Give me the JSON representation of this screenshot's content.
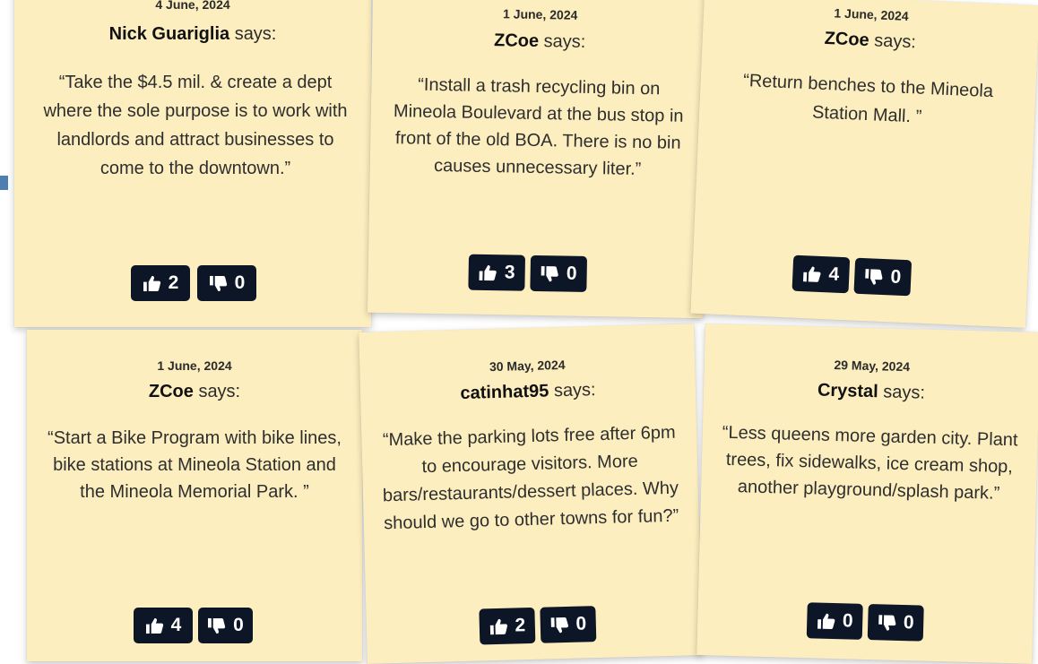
{
  "suggestions": [
    {
      "date": "4 June, 2024",
      "author": "Nick Guariglia",
      "says": "says:",
      "quote": "“Take the $4.5 mil. & create a dept where the sole purpose is to work with landlords and attract businesses to come to the downtown.”",
      "up": "2",
      "down": "0"
    },
    {
      "date": "1 June, 2024",
      "author": "ZCoe",
      "says": "says:",
      "quote": "“Install a trash recycling bin on Mineola Boulevard at the bus stop in front of the old BOA. There is no bin causes unnecessary liter.”",
      "up": "3",
      "down": "0"
    },
    {
      "date": "1 June, 2024",
      "author": "ZCoe",
      "says": "says:",
      "quote": "“Return benches to the Mineola Station Mall. ”",
      "up": "4",
      "down": "0"
    },
    {
      "date": "1 June, 2024",
      "author": "ZCoe",
      "says": "says:",
      "quote": "“Start a Bike Program with bike lines, bike stations at Mineola Station and the Mineola Memorial Park. ”",
      "up": "4",
      "down": "0"
    },
    {
      "date": "30 May, 2024",
      "author": "catinhat95",
      "says": "says:",
      "quote": "“Make the parking lots free after 6pm to encourage visitors. More bars/restaurants/dessert places. Why should we go to other towns for fun?”",
      "up": "2",
      "down": "0"
    },
    {
      "date": "29 May, 2024",
      "author": "Crystal",
      "says": "says:",
      "quote": "“Less queens more garden city. Plant trees, fix sidewalks, ice cream shop, another playground/splash park.”",
      "up": "0",
      "down": "0"
    }
  ],
  "icons": {
    "up": "thumbs-up-icon",
    "down": "thumbs-down-icon"
  },
  "colors": {
    "note_bg": "#fdeebf",
    "button_bg": "#0d1626"
  }
}
